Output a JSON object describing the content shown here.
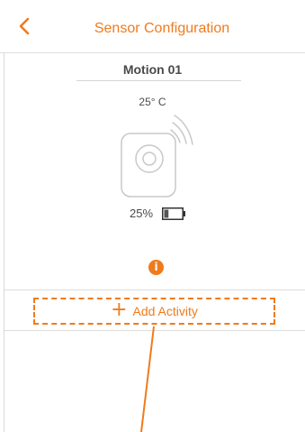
{
  "header": {
    "title": "Sensor Configuration",
    "back_icon": "chevron-left-icon"
  },
  "device": {
    "name": "Motion 01",
    "temperature": "25° C",
    "battery_percent": "25%",
    "battery_level": 0.25
  },
  "info_icon": {
    "glyph": "i"
  },
  "actions": {
    "add_activity_icon": "+",
    "add_activity_label": "Add Activity"
  },
  "colors": {
    "accent": "#f07b1c",
    "text": "#4a4a4a",
    "divider": "#dedede"
  }
}
